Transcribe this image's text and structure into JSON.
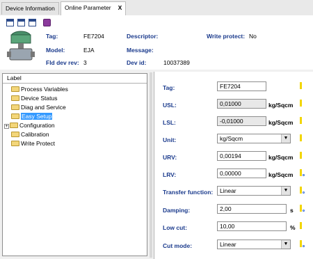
{
  "tabs": [
    {
      "label": "Device Information"
    },
    {
      "label": "Online Parameter",
      "close": "X"
    }
  ],
  "toolbar_icons": [
    "table-icon",
    "table-icon",
    "table-icon",
    "book-icon"
  ],
  "header": {
    "tag_label": "Tag:",
    "tag_value": "FE7204",
    "model_label": "Model:",
    "model_value": "EJA",
    "rev_label": "Fld dev rev:",
    "rev_value": "3",
    "descriptor_label": "Descriptor:",
    "descriptor_value": "",
    "message_label": "Message:",
    "message_value": "",
    "devid_label": "Dev id:",
    "devid_value": "10037389",
    "wp_label": "Write protect:",
    "wp_value": "No"
  },
  "tree": {
    "column_header": "Label",
    "items": [
      {
        "label": "Process Variables"
      },
      {
        "label": "Device Status"
      },
      {
        "label": "Diag and Service"
      },
      {
        "label": "Easy Setup",
        "selected": true
      },
      {
        "label": "Configuration",
        "expandable": true
      },
      {
        "label": "Calibration"
      },
      {
        "label": "Write Protect"
      }
    ]
  },
  "form": {
    "tag": {
      "label": "Tag:",
      "value": "FE7204"
    },
    "usl": {
      "label": "USL:",
      "value": "0,01000",
      "unit": "kg/Sqcm"
    },
    "lsl": {
      "label": "LSL:",
      "value": "-0,01000",
      "unit": "kg/Sqcm"
    },
    "unit": {
      "label": "Unit:",
      "value": "kg/Sqcm"
    },
    "urv": {
      "label": "URV:",
      "value": "0,00194",
      "unit": "kg/Sqcm"
    },
    "lrv": {
      "label": "LRV:",
      "value": "0,00000",
      "unit": "kg/Sqcm"
    },
    "transfer": {
      "label": "Transfer function:",
      "value": "Linear"
    },
    "damping": {
      "label": "Damping:",
      "value": "2,00",
      "unit": "s"
    },
    "lowcut": {
      "label": "Low cut:",
      "value": "10,00",
      "unit": "%"
    },
    "cutmode": {
      "label": "Cut mode:",
      "value": "Linear"
    }
  },
  "colors": {
    "label_blue": "#1a3a8c",
    "marker_yellow": "#f2d500",
    "selection": "#3399ff"
  }
}
